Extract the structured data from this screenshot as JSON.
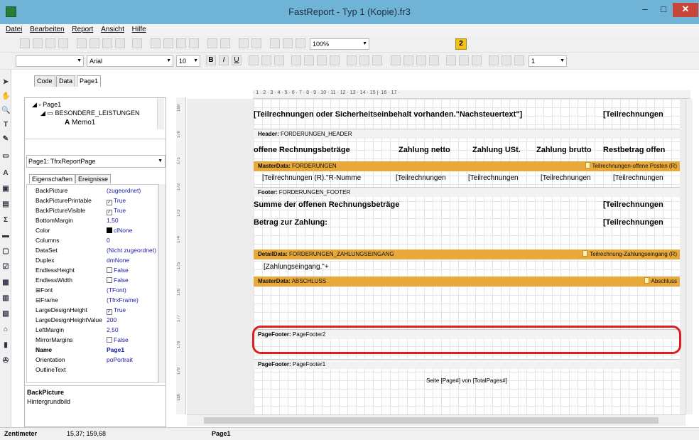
{
  "window": {
    "title": "FastReport - Typ 1 (Kopie).fr3",
    "min": "–",
    "max": "□",
    "close": "✕"
  },
  "menu": [
    "Datei",
    "Bearbeiten",
    "Report",
    "Ansicht",
    "Hilfe"
  ],
  "toolbar": {
    "zoom": "100%",
    "help_badge": "2"
  },
  "format_toolbar": {
    "font": "Arial",
    "font_size": "10",
    "bold": "B",
    "italic": "I",
    "underline": "U",
    "frame_width": "1"
  },
  "tabs": [
    "Code",
    "Data",
    "Page1"
  ],
  "tree": {
    "root": "Page1",
    "child": "BESONDERE_LEISTUNGEN",
    "leaf": "Memo1"
  },
  "page_select": "Page1: TfrxReportPage",
  "prop_tabs": [
    "Eigenschaften",
    "Ereignisse"
  ],
  "properties": [
    {
      "name": "BackPicture",
      "value": "(zugeordnet)"
    },
    {
      "name": "BackPicturePrintable",
      "value": "True",
      "check": true
    },
    {
      "name": "BackPictureVisible",
      "value": "True",
      "check": true
    },
    {
      "name": "BottomMargin",
      "value": "1,50"
    },
    {
      "name": "Color",
      "value": "clNone",
      "swatch": true
    },
    {
      "name": "Columns",
      "value": "0"
    },
    {
      "name": "DataSet",
      "value": "(Nicht zugeordnet)"
    },
    {
      "name": "Duplex",
      "value": "dmNone"
    },
    {
      "name": "EndlessHeight",
      "value": "False",
      "check": false
    },
    {
      "name": "EndlessWidth",
      "value": "False",
      "check": false
    },
    {
      "name": "⊞Font",
      "value": "(TFont)"
    },
    {
      "name": "⊟Frame",
      "value": "(TfrxFrame)"
    },
    {
      "name": "LargeDesignHeight",
      "value": "True",
      "check": true
    },
    {
      "name": "LargeDesignHeightValue",
      "value": "200"
    },
    {
      "name": "LeftMargin",
      "value": "2,50"
    },
    {
      "name": "MirrorMargins",
      "value": "False",
      "check": false
    },
    {
      "name": "Name",
      "value": "Page1",
      "bold": true
    },
    {
      "name": "Orientation",
      "value": "poPortrait"
    },
    {
      "name": "OutlineText",
      "value": ""
    }
  ],
  "description": {
    "title": "BackPicture",
    "text": "Hintergrundbild"
  },
  "ruler": "·  1  ·  2  ·  3  ·  4  ·  5  ·  6  ·  7  ·  8  ·  9  ·  10  ·  11  ·  12  ·  13  ·  14  ·  15  |·  16  ·  17  ·",
  "vruler_marks": [
    "169",
    "170",
    "171",
    "172",
    "173",
    "174",
    "175",
    "176",
    "177",
    "178",
    "179",
    "180"
  ],
  "report": {
    "top_memo_1": "[Teilrechnungen oder Sicherheitseinbehalt vorhanden.\"Nachsteuertext\"]",
    "top_memo_2": "[Teilrechnungen",
    "header_label": "Header:",
    "header_name": "FORDERUNGEN_HEADER",
    "header_cols": [
      "offene Rechnungsbeträge",
      "Zahlung netto",
      "Zahlung USt.",
      "Zahlung brutto",
      "Restbetrag offen"
    ],
    "master1_label": "MasterData:",
    "master1_name": "FORDERUNGEN",
    "master1_right": "Teilrechnungen-offene Posten (R)",
    "master1_cells": [
      "[Teilrechnungen (R).\"R-Numme",
      "[Teilrechnungen",
      "[Teilrechnungen",
      "[Teilrechnungen",
      "[Teilrechnungen"
    ],
    "footer_label": "Footer:",
    "footer_name": "FORDERUNGEN_FOOTER",
    "footer_row1_left": "Summe der offenen Rechnungsbeträge",
    "footer_row1_right": "[Teilrechnungen",
    "footer_row2_left": "Betrag zur Zahlung:",
    "footer_row2_right": "[Teilrechnungen",
    "detail_label": "DetailData:",
    "detail_name": "FORDERUNGEN_ZAHLUNGSEINGANG",
    "detail_right": "Teilrechnung-Zahlungseingang (R)",
    "detail_memo": "[Zahlungseingang.\"+",
    "master2_label": "MasterData:",
    "master2_name": "ABSCHLUSS",
    "master2_right": "Abschluss",
    "pf2_label": "PageFooter:",
    "pf2_name": "PageFooter2",
    "pf1_label": "PageFooter:",
    "pf1_name": "PageFooter1",
    "pf1_memo": "Seite [Page#] von [TotalPages#]"
  },
  "status": {
    "unit": "Zentimeter",
    "coords": "15,37; 159,68",
    "page": "Page1"
  },
  "colors": {
    "title_bg": "#6fb3d6",
    "band_orange": "#e8a83a",
    "highlight_red": "#dd1f1f"
  }
}
